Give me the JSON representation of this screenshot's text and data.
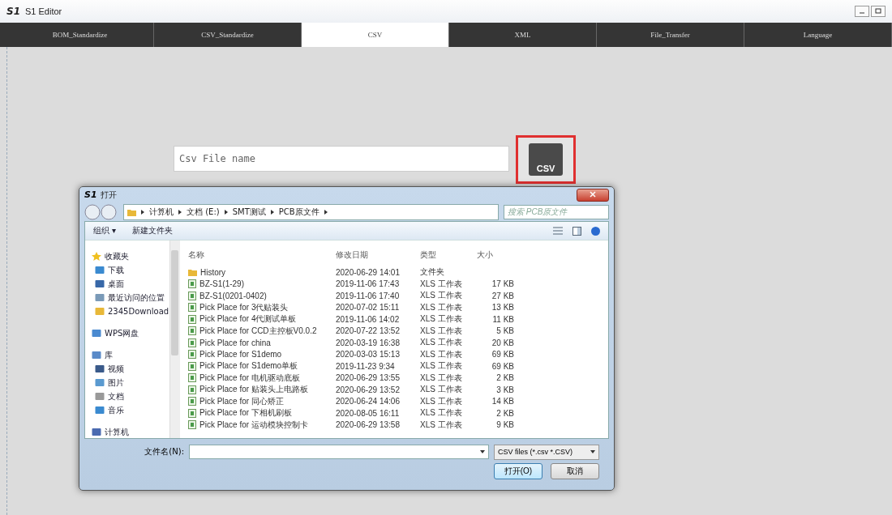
{
  "window": {
    "logo": "S1",
    "title": "S1 Editor"
  },
  "tabs": [
    {
      "label": "BOM_Standardize",
      "selected": false
    },
    {
      "label": "CSV_Standardize",
      "selected": false
    },
    {
      "label": "CSV",
      "selected": true
    },
    {
      "label": "XML",
      "selected": false
    },
    {
      "label": "File_Transfer",
      "selected": false
    },
    {
      "label": "Language",
      "selected": false
    }
  ],
  "file_field": {
    "placeholder": "Csv File name"
  },
  "csv_button": {
    "label": "CSV"
  },
  "dialog": {
    "logo": "S1",
    "title": "打开",
    "breadcrumb": [
      "计算机",
      "文档 (E:)",
      "SMT测试",
      "PCB原文件"
    ],
    "search": {
      "placeholder": "搜索 PCB原文件"
    },
    "toolbar": [
      {
        "label": "组织 ▾"
      },
      {
        "label": "新建文件夹"
      }
    ],
    "sidebar": [
      {
        "label": "收藏夹",
        "kind": "star",
        "children": [
          {
            "label": "下载",
            "kind": "download"
          },
          {
            "label": "桌面",
            "kind": "desktop"
          },
          {
            "label": "最近访问的位置",
            "kind": "recent"
          },
          {
            "label": "2345Download",
            "kind": "folder"
          }
        ]
      },
      {
        "label": "WPS网盘",
        "kind": "cloud"
      },
      {
        "label": "库",
        "kind": "library",
        "children": [
          {
            "label": "视频",
            "kind": "video"
          },
          {
            "label": "图片",
            "kind": "image"
          },
          {
            "label": "文档",
            "kind": "doc"
          },
          {
            "label": "音乐",
            "kind": "music"
          }
        ]
      },
      {
        "label": "计算机",
        "kind": "computer"
      }
    ],
    "columns": [
      "名称",
      "修改日期",
      "类型",
      "大小"
    ],
    "files": [
      {
        "name": "History",
        "kind": "folder",
        "date": "2020-06-29 14:01",
        "type": "文件夹"
      },
      {
        "name": "BZ-S1(1-29)",
        "kind": "sheet",
        "date": "2019-11-06 17:43",
        "type": "XLS 工作表",
        "size": "17 KB"
      },
      {
        "name": "BZ-S1(0201-0402)",
        "kind": "sheet",
        "date": "2019-11-06 17:40",
        "type": "XLS 工作表",
        "size": "27 KB"
      },
      {
        "name": "Pick Place for 3代贴装头",
        "kind": "sheet",
        "date": "2020-07-02 15:11",
        "type": "XLS 工作表",
        "size": "13 KB"
      },
      {
        "name": "Pick Place for 4代测试单板",
        "kind": "sheet",
        "date": "2019-11-06 14:02",
        "type": "XLS 工作表",
        "size": "11 KB"
      },
      {
        "name": "Pick Place for CCD主控板V0.0.2",
        "kind": "sheet",
        "date": "2020-07-22 13:52",
        "type": "XLS 工作表",
        "size": "5 KB"
      },
      {
        "name": "Pick Place for china",
        "kind": "sheet",
        "date": "2020-03-19 16:38",
        "type": "XLS 工作表",
        "size": "20 KB"
      },
      {
        "name": "Pick Place for S1demo",
        "kind": "sheet",
        "date": "2020-03-03 15:13",
        "type": "XLS 工作表",
        "size": "69 KB"
      },
      {
        "name": "Pick Place for S1demo单板",
        "kind": "sheet",
        "date": "2019-11-23 9:34",
        "type": "XLS 工作表",
        "size": "69 KB"
      },
      {
        "name": "Pick Place for 电机驱动底板",
        "kind": "sheet",
        "date": "2020-06-29 13:55",
        "type": "XLS 工作表",
        "size": "2 KB"
      },
      {
        "name": "Pick Place for 贴装头上电路板",
        "kind": "sheet",
        "date": "2020-06-29 13:52",
        "type": "XLS 工作表",
        "size": "3 KB"
      },
      {
        "name": "Pick Place for 同心矫正",
        "kind": "sheet",
        "date": "2020-06-24 14:06",
        "type": "XLS 工作表",
        "size": "14 KB"
      },
      {
        "name": "Pick Place for 下相机刷板",
        "kind": "sheet",
        "date": "2020-08-05 16:11",
        "type": "XLS 工作表",
        "size": "2 KB"
      },
      {
        "name": "Pick Place for 运动模块控制卡",
        "kind": "sheet",
        "date": "2020-06-29 13:58",
        "type": "XLS 工作表",
        "size": "9 KB"
      }
    ],
    "filename_label": "文件名(N):",
    "filter": "CSV files (*.csv *.CSV)",
    "buttons": [
      {
        "label": "打开(O)",
        "kind": "primary"
      },
      {
        "label": "取消",
        "kind": "normal"
      }
    ]
  }
}
